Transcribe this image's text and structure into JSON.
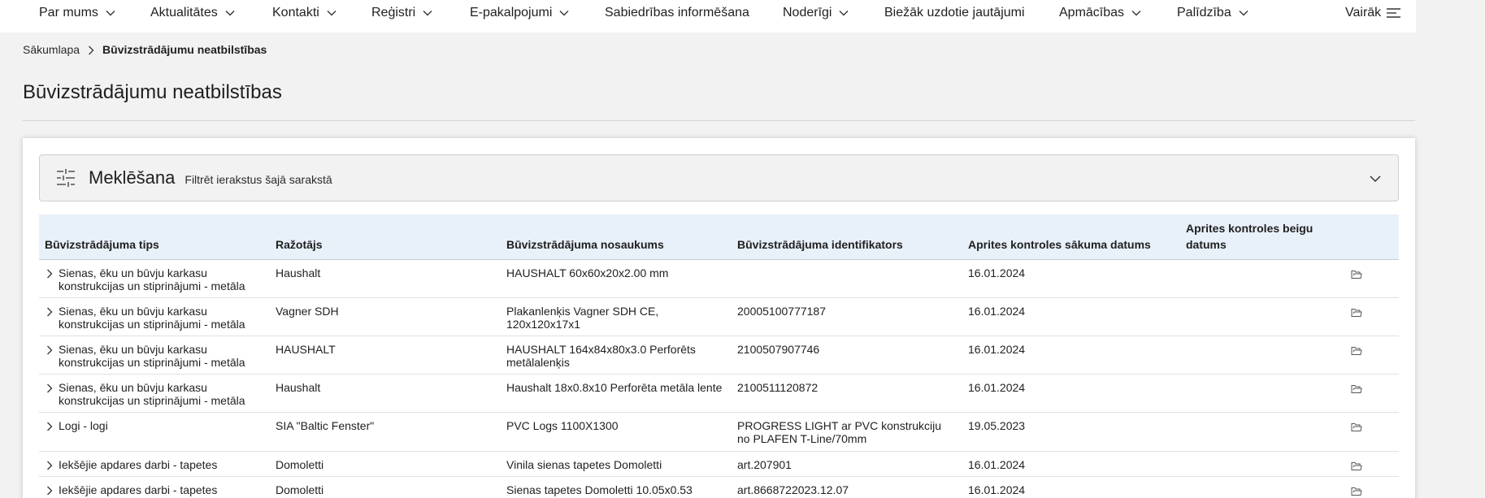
{
  "nav": {
    "items": [
      {
        "label": "Par mums",
        "has_dropdown": true
      },
      {
        "label": "Aktualitātes",
        "has_dropdown": true
      },
      {
        "label": "Kontakti",
        "has_dropdown": true
      },
      {
        "label": "Reģistri",
        "has_dropdown": true
      },
      {
        "label": "E-pakalpojumi",
        "has_dropdown": true
      },
      {
        "label": "Sabiedrības informēšana",
        "has_dropdown": false
      },
      {
        "label": "Noderīgi",
        "has_dropdown": true
      },
      {
        "label": "Biežāk uzdotie jautājumi",
        "has_dropdown": false
      },
      {
        "label": "Apmācības",
        "has_dropdown": true
      },
      {
        "label": "Palīdzība",
        "has_dropdown": true
      }
    ],
    "more_label": "Vairāk"
  },
  "breadcrumb": {
    "home": "Sākumlapa",
    "current": "Būvizstrādājumu neatbilstības"
  },
  "page_title": "Būvizstrādājumu neatbilstības",
  "search": {
    "title": "Meklēšana",
    "subtitle": "Filtrēt ierakstus šajā sarakstā"
  },
  "table": {
    "headers": [
      "Būvizstrādājuma tips",
      "Ražotājs",
      "Būvizstrādājuma nosaukums",
      "Būvizstrādājuma identifikators",
      "Aprites kontroles sākuma datums",
      "Aprites kontroles beigu datums"
    ],
    "rows": [
      {
        "type": "Sienas, ēku un būvju karkasu konstrukcijas un stiprinājumi - metāla",
        "maker": "Haushalt",
        "name": "HAUSHALT 60x60x20x2.00 mm",
        "id": "",
        "start": "16.01.2024",
        "end": ""
      },
      {
        "type": "Sienas, ēku un būvju karkasu konstrukcijas un stiprinājumi - metāla",
        "maker": "Vagner SDH",
        "name": "Plakanlenķis Vagner SDH CE, 120x120x17x1",
        "id": "20005100777187",
        "start": "16.01.2024",
        "end": ""
      },
      {
        "type": "Sienas, ēku un būvju karkasu konstrukcijas un stiprinājumi - metāla",
        "maker": "HAUSHALT",
        "name": "HAUSHALT 164x84x80x3.0 Perforēts metālalenķis",
        "id": "2100507907746",
        "start": "16.01.2024",
        "end": ""
      },
      {
        "type": "Sienas, ēku un būvju karkasu konstrukcijas un stiprinājumi - metāla",
        "maker": "Haushalt",
        "name": "Haushalt 18x0.8x10 Perforēta metāla lente",
        "id": "2100511120872",
        "start": "16.01.2024",
        "end": ""
      },
      {
        "type": "Logi - logi",
        "maker": "SIA \"Baltic Fenster\"",
        "name": "PVC Logs 1100X1300",
        "id": "PROGRESS LIGHT ar PVC konstrukciju no PLAFEN T-Line/70mm",
        "start": "19.05.2023",
        "end": ""
      },
      {
        "type": "Iekšējie apdares darbi - tapetes",
        "maker": "Domoletti",
        "name": "Vinila sienas tapetes Domoletti",
        "id": "art.207901",
        "start": "16.01.2024",
        "end": ""
      },
      {
        "type": "Iekšējie apdares darbi - tapetes",
        "maker": "Domoletti",
        "name": "Sienas tapetes Domoletti 10.05x0.53",
        "id": "art.8668722023.12.07",
        "start": "16.01.2024",
        "end": ""
      }
    ]
  }
}
